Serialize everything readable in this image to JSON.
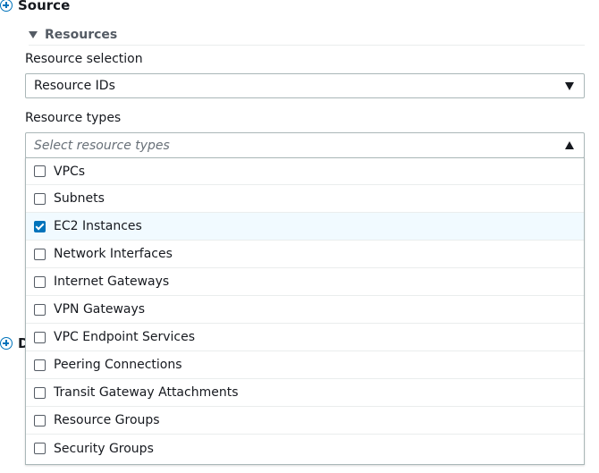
{
  "section": {
    "title": "Source",
    "second_title_partial": "D"
  },
  "expander": {
    "label": "Resources"
  },
  "resource_selection": {
    "label": "Resource selection",
    "value": "Resource IDs"
  },
  "resource_types": {
    "label": "Resource types",
    "placeholder": "Select resource types",
    "options": [
      {
        "label": "VPCs",
        "checked": false
      },
      {
        "label": "Subnets",
        "checked": false
      },
      {
        "label": "EC2 Instances",
        "checked": true
      },
      {
        "label": "Network Interfaces",
        "checked": false
      },
      {
        "label": "Internet Gateways",
        "checked": false
      },
      {
        "label": "VPN Gateways",
        "checked": false
      },
      {
        "label": "VPC Endpoint Services",
        "checked": false
      },
      {
        "label": "Peering Connections",
        "checked": false
      },
      {
        "label": "Transit Gateway Attachments",
        "checked": false
      },
      {
        "label": "Resource Groups",
        "checked": false
      },
      {
        "label": "Security Groups",
        "checked": false
      }
    ]
  },
  "colors": {
    "accent": "#0073bb",
    "selected_row": "#f1faff",
    "border": "#aab7b8"
  }
}
